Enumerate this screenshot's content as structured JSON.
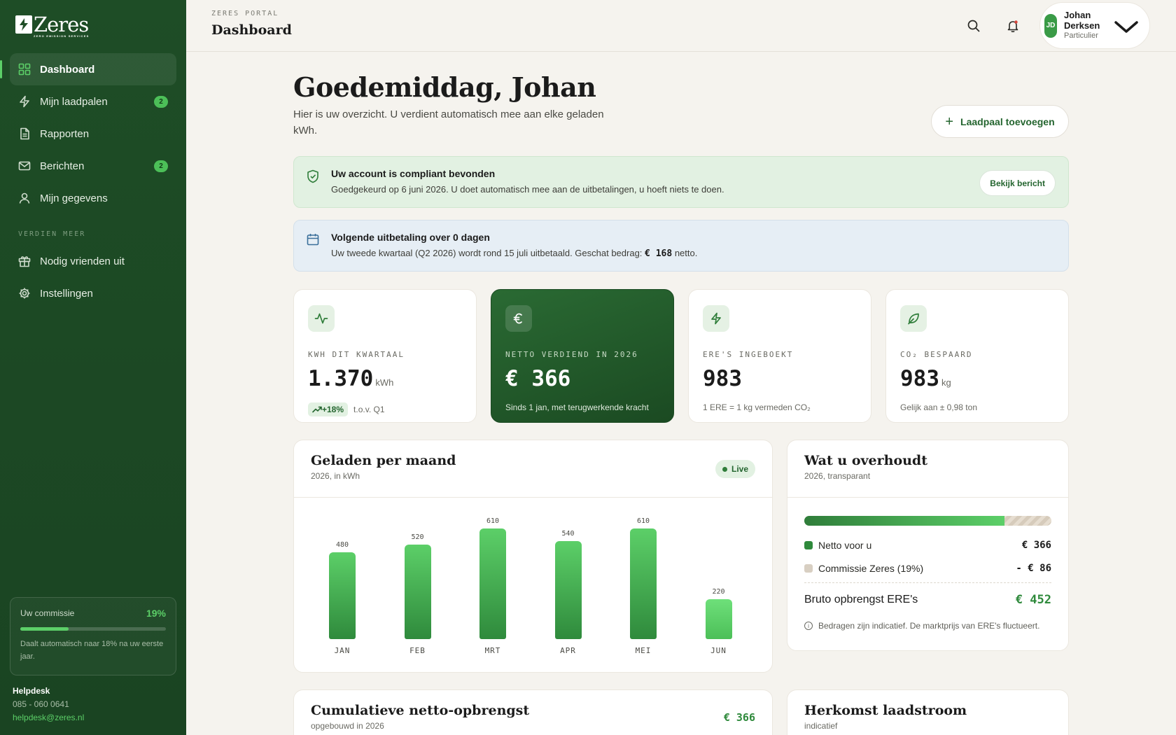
{
  "sidebar": {
    "logo_text": "Zeres",
    "logo_tagline": "ZERO EMISSION SERVICES",
    "items": [
      {
        "label": "Dashboard",
        "badge": ""
      },
      {
        "label": "Mijn laadpalen",
        "badge": "2"
      },
      {
        "label": "Rapporten",
        "badge": ""
      },
      {
        "label": "Berichten",
        "badge": "2"
      },
      {
        "label": "Mijn gegevens",
        "badge": ""
      }
    ],
    "section_label": "VERDIEN MEER",
    "extra_items": [
      {
        "label": "Nodig vrienden uit"
      },
      {
        "label": "Instellingen"
      }
    ],
    "commission": {
      "label": "Uw commissie",
      "value": "19%",
      "progress_fraction": 0.33,
      "note": "Daalt automatisch naar 18% na uw eerste jaar."
    },
    "helpdesk": {
      "title": "Helpdesk",
      "phone": "085 - 060 0641",
      "email": "helpdesk@zeres.nl"
    }
  },
  "topbar": {
    "eyebrow": "ZERES PORTAL",
    "title": "Dashboard",
    "user": {
      "initials": "JD",
      "name_first": "Johan",
      "name_last": "Derksen",
      "role": "Particulier"
    }
  },
  "main": {
    "greeting": "Goedemiddag, Johan",
    "subtitle": "Hier is uw overzicht. U verdient automatisch mee aan elke geladen kWh.",
    "add_button": "Laadpaal toevoegen",
    "compliance": {
      "title": "Uw account is compliant bevonden",
      "body": "Goedgekeurd op 6 juni 2026. U doet automatisch mee aan de uitbetalingen, u hoeft niets te doen.",
      "button": "Bekijk bericht"
    },
    "payout": {
      "title": "Volgende uitbetaling over 0 dagen",
      "body_before": "Uw tweede kwartaal (Q2 2026) wordt rond 15 juli uitbetaald. Geschat bedrag:",
      "amount": "€ 168",
      "body_after": "netto."
    },
    "stats": [
      {
        "label": "KWH DIT KWARTAAL",
        "value": "1.370",
        "unit": "kWh",
        "delta": "+18%",
        "foot": "t.o.v. Q1"
      },
      {
        "label": "NETTO VERDIEND IN 2026",
        "value": "€ 366",
        "unit": "",
        "foot": "Sinds 1 jan, met terugwerkende kracht"
      },
      {
        "label": "ERE'S INGEBOEKT",
        "value": "983",
        "unit": "",
        "foot": "1 ERE = 1 kg vermeden CO₂"
      },
      {
        "label": "CO₂ BESPAARD",
        "value": "983",
        "unit": "kg",
        "foot": "Gelijk aan ± 0,98 ton"
      }
    ],
    "chart_panel": {
      "title": "Geladen per maand",
      "subtitle": "2026, in kWh",
      "live_label": "Live"
    },
    "split_panel": {
      "title": "Wat u overhoudt",
      "subtitle": "2026, transparant",
      "net_fraction": 0.81,
      "net_label": "Netto voor u",
      "net_amount": "€ 366",
      "net_color": "#2f8a3c",
      "commission_label": "Commissie Zeres (19%)",
      "commission_amount": "- € 86",
      "commission_color": "#d8cfc2",
      "gross_label": "Bruto opbrengst ERE's",
      "gross_amount": "€ 452",
      "disclaimer": "Bedragen zijn indicatief. De marktprijs van ERE's fluctueert."
    },
    "cumulative_panel": {
      "title": "Cumulatieve netto-opbrengst",
      "subtitle": "opgebouwd in 2026",
      "amount": "€ 366"
    },
    "origin_panel": {
      "title": "Herkomst laadstroom",
      "subtitle": "indicatief"
    }
  },
  "chart_data": {
    "type": "bar",
    "categories": [
      "JAN",
      "FEB",
      "MRT",
      "APR",
      "MEI",
      "JUN"
    ],
    "values": [
      480,
      520,
      610,
      540,
      610,
      220
    ],
    "title": "Geladen per maand",
    "subtitle": "2026, in kWh",
    "ylim": [
      0,
      610
    ],
    "grid": false,
    "highlight_last": true
  }
}
